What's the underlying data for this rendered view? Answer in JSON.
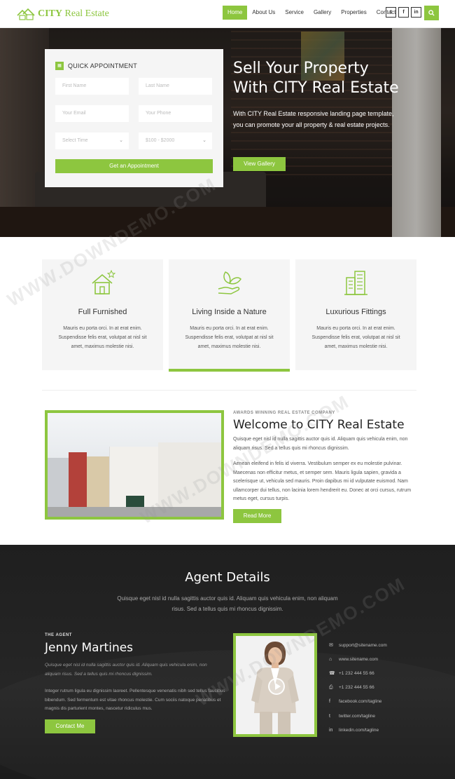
{
  "header": {
    "logo_city": "CITY",
    "logo_re": "Real Estate",
    "nav": [
      "Home",
      "About Us",
      "Service",
      "Gallery",
      "Properties",
      "Contact"
    ],
    "social": [
      "t",
      "f",
      "in"
    ]
  },
  "hero": {
    "form_title": "QUICK APPOINTMENT",
    "first_name_placeholder": "First Name",
    "last_name_placeholder": "Last Name",
    "email_placeholder": "Your Email",
    "phone_placeholder": "Your Phone",
    "time_select": "Select Time",
    "budget_select": "$100 - $2000",
    "submit_label": "Get an Appointment",
    "title_line1": "Sell Your Property",
    "title_line2": "With CITY Real Estate",
    "description": "With CITY Real Estate responsive landing page template, you can promote your all property & real estate projects.",
    "gallery_button": "View Gallery"
  },
  "features": [
    {
      "title": "Full Furnished",
      "text": "Mauris eu porta orci. In at erat enim. Suspendisse felis erat, volutpat at nisl sit amet, maximus molestie nisi.",
      "icon": "house-star-icon"
    },
    {
      "title": "Living Inside a Nature",
      "text": "Mauris eu porta orci. In at erat enim. Suspendisse felis erat, volutpat at nisl sit amet, maximus molestie nisi.",
      "icon": "hand-leaf-icon"
    },
    {
      "title": "Luxurious Fittings",
      "text": "Mauris eu porta orci. In at erat enim. Suspendisse felis erat, volutpat at nisl sit amet, maximus molestie nisi.",
      "icon": "buildings-icon"
    }
  ],
  "welcome": {
    "subtitle": "AWARDS WINNING REAL ESTATE COMPANY",
    "title": "Welcome to CITY Real Estate",
    "p1": "Quisque eget nisl id nulla sagittis auctor quis id. Aliquam quis vehicula enim, non aliquam risus. Sed a tellus quis mi rhoncus dignissim.",
    "p2": "Aenean eleifend in felis id viverra. Vestibulum semper ex eu molestie pulvinar. Maecenas non efficitur metus, et semper sem. Mauris ligula sapien, gravida a scelerisque ut, vehicula sed mauris. Proin dapibus mi id vulputate euismod. Nam ullamcorper dui tellus, non lacinia lorem hendrerit eu. Donec at orci cursus, rutrum metus eget, cursus turpis.",
    "button": "Read More"
  },
  "agent": {
    "title": "Agent Details",
    "subtitle": "Quisque eget nisl id nulla sagittis auctor quis id. Aliquam quis vehicula enim, non aliquam risus. Sed a tellus quis mi rhoncus dignissim.",
    "label": "THE AGENT",
    "name": "Jenny Martines",
    "quote": "Quisque eget nisl id nulla sagittis auctor quis id. Aliquam quis vehicula enim, non aliquam risus. Sed a tellus quis mi rhoncus dignissim.",
    "paragraph": "Integer rutrum ligula eu dignissim laoreet. Pellentesque venenatis nibh sed tellus faucibus bibendum. Sed fermentum est vitae rhoncus molestie. Cum sociis natoque penatibus et magnis dis parturient montes, nascetur ridiculus mus.",
    "button": "Contact Me",
    "contacts": [
      {
        "icon": "✉",
        "text": "support@sitename.com"
      },
      {
        "icon": "⌂",
        "text": "www.sitename.com"
      },
      {
        "icon": "☎",
        "text": "+1 232 444 55 66"
      },
      {
        "icon": "⎙",
        "text": "+1 232 444 55 66"
      },
      {
        "icon": "f",
        "text": "facebook.com/tagline"
      },
      {
        "icon": "t",
        "text": "twitter.com/tagline"
      },
      {
        "icon": "in",
        "text": "linkedin.com/tagline"
      }
    ]
  },
  "watermark": "WWW.DOWNDEMO.COM",
  "colors": {
    "accent": "#8dc63f",
    "dark": "#222222"
  }
}
